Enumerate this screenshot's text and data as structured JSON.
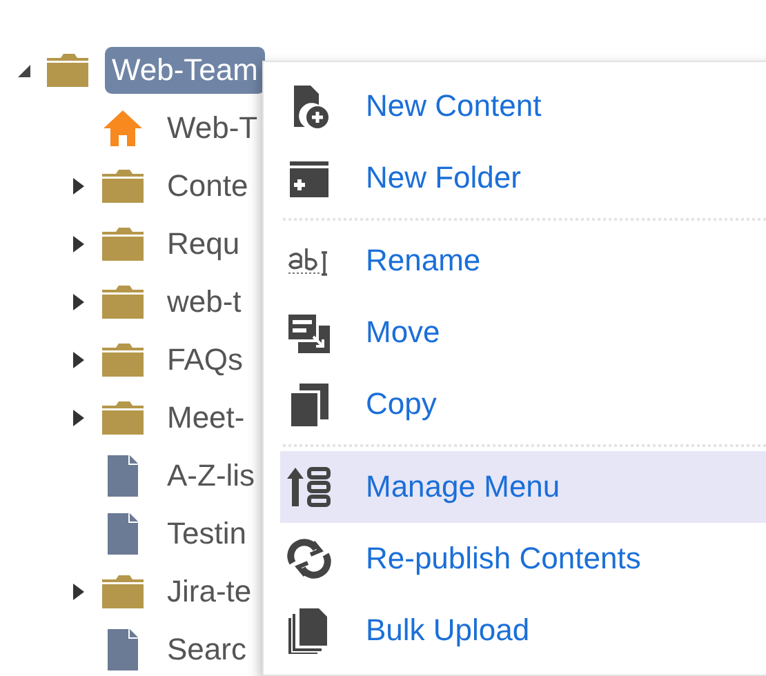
{
  "tree": {
    "root": {
      "label": "Web-Team",
      "kind": "folder",
      "expanded": true,
      "selected": true,
      "children": [
        {
          "label": "Web-T",
          "kind": "home"
        },
        {
          "label": "Conte",
          "kind": "folder",
          "expanded": false
        },
        {
          "label": "Requ",
          "kind": "folder",
          "expanded": false
        },
        {
          "label": "web-t",
          "kind": "folder",
          "expanded": false
        },
        {
          "label": "FAQs",
          "kind": "folder",
          "expanded": false
        },
        {
          "label": "Meet-",
          "kind": "folder",
          "expanded": false
        },
        {
          "label": "A-Z-lis",
          "kind": "document"
        },
        {
          "label": "Testin",
          "kind": "document"
        },
        {
          "label": "Jira-te",
          "kind": "folder",
          "expanded": false
        },
        {
          "label": "Searc",
          "kind": "document"
        }
      ]
    }
  },
  "context_menu": {
    "groups": [
      [
        {
          "label": "New Content",
          "selected": false
        },
        {
          "label": "New Folder",
          "selected": false
        }
      ],
      [
        {
          "label": "Rename",
          "selected": false
        },
        {
          "label": "Move",
          "selected": false
        },
        {
          "label": "Copy",
          "selected": false
        }
      ],
      [
        {
          "label": "Manage Menu",
          "selected": true
        },
        {
          "label": "Re-publish Contents",
          "selected": false
        },
        {
          "label": "Bulk Upload",
          "selected": false
        }
      ]
    ]
  }
}
